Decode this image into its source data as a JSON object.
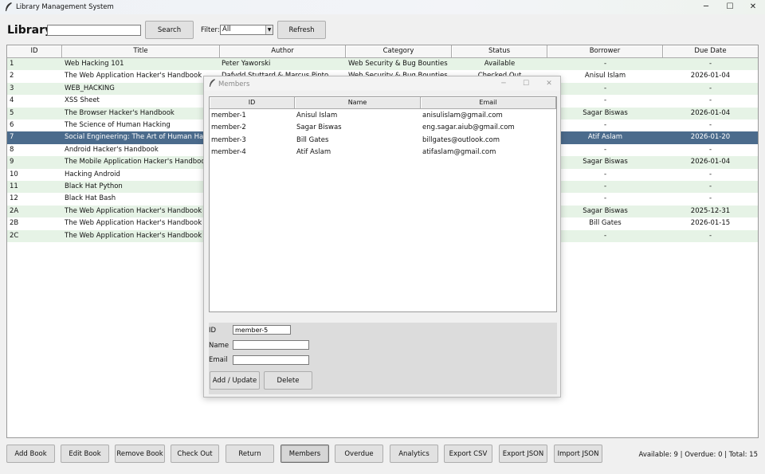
{
  "window": {
    "title": "Library Management System",
    "controls": {
      "minimize": "─",
      "maximize": "☐",
      "close": "✕"
    }
  },
  "toolbar": {
    "heading": "Library",
    "search_value": "",
    "search_label": "Search",
    "filter_label": "Filter:",
    "filter_value": "All",
    "refresh_label": "Refresh"
  },
  "books": {
    "columns": [
      "ID",
      "Title",
      "Author",
      "Category",
      "Status",
      "Borrower",
      "Due Date"
    ],
    "rows": [
      [
        "1",
        "Web Hacking 101",
        "Peter Yaworski",
        "Web Security & Bug Bounties",
        "Available",
        "-",
        "-"
      ],
      [
        "2",
        "The Web Application Hacker's Handbook",
        "Dafydd Stuttard & Marcus Pinto",
        "Web Security & Bug Bounties",
        "Checked Out",
        "Anisul Islam",
        "2026-01-04"
      ],
      [
        "3",
        "WEB_HACKING",
        "",
        "",
        "",
        "-",
        "-"
      ],
      [
        "4",
        "XSS Sheet",
        "",
        "",
        "",
        "-",
        "-"
      ],
      [
        "5",
        "The Browser Hacker's Handbook",
        "",
        "",
        "",
        "Sagar Biswas",
        "2026-01-04"
      ],
      [
        "6",
        "The Science of Human Hacking",
        "",
        "",
        "",
        "-",
        "-"
      ],
      [
        "7",
        "Social Engineering: The Art of Human Hacking",
        "",
        "",
        "",
        "Atif Aslam",
        "2026-01-20"
      ],
      [
        "8",
        "Android Hacker's Handbook",
        "",
        "",
        "",
        "-",
        "-"
      ],
      [
        "9",
        "The Mobile Application Hacker's Handbook",
        "",
        "",
        "",
        "Sagar Biswas",
        "2026-01-04"
      ],
      [
        "10",
        "Hacking Android",
        "",
        "",
        "",
        "-",
        "-"
      ],
      [
        "11",
        "Black Hat Python",
        "",
        "",
        "",
        "-",
        "-"
      ],
      [
        "12",
        "Black Hat Bash",
        "",
        "",
        "",
        "-",
        "-"
      ],
      [
        "2A",
        "The Web Application Hacker's Handbook",
        "",
        "",
        "",
        "Sagar Biswas",
        "2025-12-31"
      ],
      [
        "2B",
        "The Web Application Hacker's Handbook",
        "",
        "",
        "",
        "Bill Gates",
        "2026-01-15"
      ],
      [
        "2C",
        "The Web Application Hacker's Handbook",
        "",
        "",
        "",
        "-",
        "-"
      ]
    ],
    "selected_row": 6
  },
  "actions": [
    "Add Book",
    "Edit Book",
    "Remove Book",
    "Check Out",
    "Return",
    "Members",
    "Overdue",
    "Analytics",
    "Export CSV",
    "Export JSON",
    "Import JSON"
  ],
  "active_action": 5,
  "status_summary": "Available: 9 | Overdue: 0 | Total: 15",
  "members_dialog": {
    "title": "Members",
    "columns": [
      "ID",
      "Name",
      "Email"
    ],
    "rows": [
      [
        "member-1",
        "Anisul Islam",
        "anisulislam@gmail.com"
      ],
      [
        "member-2",
        "Sagar Biswas",
        "eng.sagar.aiub@gmail.com"
      ],
      [
        "member-3",
        "Bill Gates",
        "billgates@outlook.com"
      ],
      [
        "member-4",
        "Atif Aslam",
        "atifaslam@gmail.com"
      ]
    ],
    "form": {
      "id_label": "ID",
      "id_value": "member-5",
      "name_label": "Name",
      "name_value": "",
      "email_label": "Email",
      "email_value": "",
      "add_update_label": "Add / Update",
      "delete_label": "Delete"
    }
  }
}
